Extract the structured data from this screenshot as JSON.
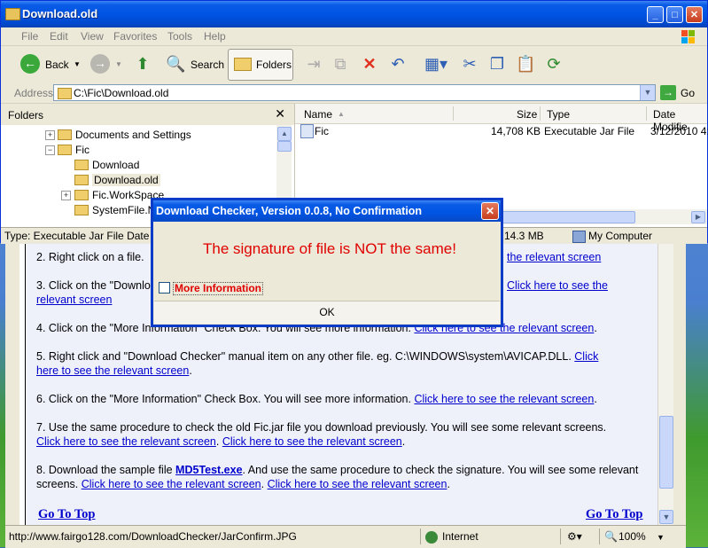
{
  "explorer": {
    "title": "Download.old",
    "menu": [
      "File",
      "Edit",
      "View",
      "Favorites",
      "Tools",
      "Help"
    ],
    "toolbar": {
      "back": "Back",
      "search": "Search",
      "folders": "Folders"
    },
    "address": {
      "label": "Address",
      "value": "C:\\Fic\\Download.old",
      "go": "Go"
    },
    "folders_pane": {
      "title": "Folders",
      "items": [
        {
          "label": "Documents and Settings",
          "expander": "+"
        },
        {
          "label": "Fic",
          "expander": "−"
        },
        {
          "label": "Download",
          "expander": ""
        },
        {
          "label": "Download.old",
          "expander": ""
        },
        {
          "label": "Fic.WorkSpace",
          "expander": "+"
        },
        {
          "label": "SystemFile.No",
          "expander": ""
        }
      ]
    },
    "files": {
      "columns": [
        "Name",
        "Size",
        "Type",
        "Date Modifie"
      ],
      "rows": [
        {
          "name": "Fic",
          "size": "14,708 KB",
          "type": "Executable Jar File",
          "date": "3/12/2010 4:"
        }
      ]
    },
    "status": {
      "left": "Type: Executable Jar File Date Mo",
      "size": "14.3 MB",
      "zone": "My Computer"
    }
  },
  "dialog": {
    "title": "Download Checker, Version 0.0.8, No Confirmation",
    "message": "The signature of file is NOT the same!",
    "checkbox_label": "More Information",
    "ok": "OK"
  },
  "page": {
    "p2a": "2. Right click on a file.",
    "p2link": "the relevant screen",
    "p3a": "3. Click on the \"Downlo",
    "p3link1": "Click here to see the",
    "p3link2": "relevant screen",
    "p4a": "4. Click on the \"More Information\" Check Box. You will see more information.",
    "p4link": "Click here to see the relevant screen",
    "p5a": "5. Right click and \"Download Checker\" manual item on any other file. eg. C:\\WINDOWS\\system\\AVICAP.DLL.",
    "p5link1": "Click",
    "p5link2": "here to see the relevant screen",
    "p6a": "6. Click on the \"More Information\" Check Box. You will see more information.",
    "p6link": "Click here to see the relevant screen",
    "p7a": "7. Use the same procedure to check the old Fic.jar file you download previously. You will see some relevant screens.",
    "p7link1": "Click here to see the relevant screen",
    "p7link2": "Click here to see the relevant screen",
    "p8a": "8. Download the sample file",
    "p8file": "MD5Test.exe",
    "p8b": ". And use the same procedure to check the signature. You will see some relevant screens.",
    "p8link1": "Click here to see the relevant screen",
    "p8link2": "Click here to see the relevant screen",
    "goto_left": "Go To Top",
    "goto_right": "Go To Top"
  },
  "browser_status": {
    "url": "http://www.fairgo128.com/DownloadChecker/JarConfirm.JPG",
    "zone": "Internet",
    "zoom": "100%"
  },
  "colors": {
    "accent": "#0054e3",
    "alert": "#e00000",
    "link": "#0000cc"
  }
}
